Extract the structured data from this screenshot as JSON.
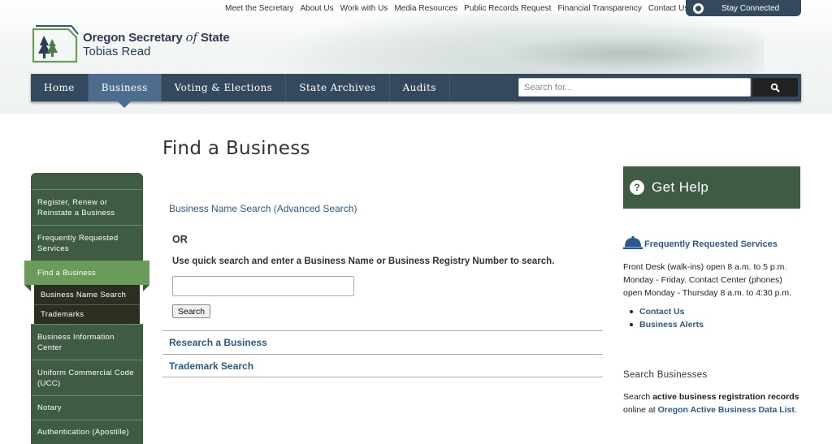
{
  "utility_nav": [
    "Meet the Secretary",
    "About Us",
    "Work with Us",
    "Media Resources",
    "Public Records Request",
    "Financial Transparency",
    "Contact Us"
  ],
  "stay_connected": "Stay Connected",
  "logo": {
    "line1_a": "Oregon Secretary",
    "line1_b": "of",
    "line1_c": "State",
    "line2": "Tobias Read"
  },
  "main_nav": [
    {
      "label": "Home"
    },
    {
      "label": "Business",
      "active": true
    },
    {
      "label": "Voting & Elections"
    },
    {
      "label": "State Archives"
    },
    {
      "label": "Audits"
    }
  ],
  "search": {
    "placeholder": "Search for..."
  },
  "page_title": "Find a Business",
  "sidebar": {
    "items_top": [
      "Register, Renew or Reinstate a Business",
      "Frequently Requested Services"
    ],
    "active": "Find a Business",
    "sub_items": [
      "Business Name Search",
      "Trademarks"
    ],
    "items_bottom": [
      "Business Information Center",
      "Uniform Commercial Code (UCC)",
      "Notary",
      "Authentication (Apostille)"
    ]
  },
  "main": {
    "advanced_link": "Business Name Search (Advanced Search)",
    "or": "OR",
    "instructions": "Use quick search and enter a Business Name or Business Registry Number to search.",
    "search_button": "Search",
    "sections": [
      "Research a Business",
      "Trademark Search"
    ]
  },
  "help": {
    "title": "Get Help",
    "frs_link": "Frequently Requested Services",
    "hours_1": "Front Desk (walk-ins) open 8 a.m. to 5 p.m. Monday - Friday. Contact Center (phones) open Monday - Thursday 8 a.m. to 4:30 p.m.",
    "links": [
      "Contact Us",
      "Business Alerts"
    ],
    "search_heading": "Search Businesses",
    "search_text_a": "Search ",
    "search_text_b": "active business registration records",
    "search_text_c": " online at ",
    "search_link": "Oregon Active Business Data List",
    "search_text_d": "."
  },
  "colors": {
    "nav": "#34495e",
    "nav_active": "#4e6d8e",
    "sidebar": "#3f5b43",
    "sidebar_active": "#6a9b58",
    "link": "#2a5a8a"
  }
}
